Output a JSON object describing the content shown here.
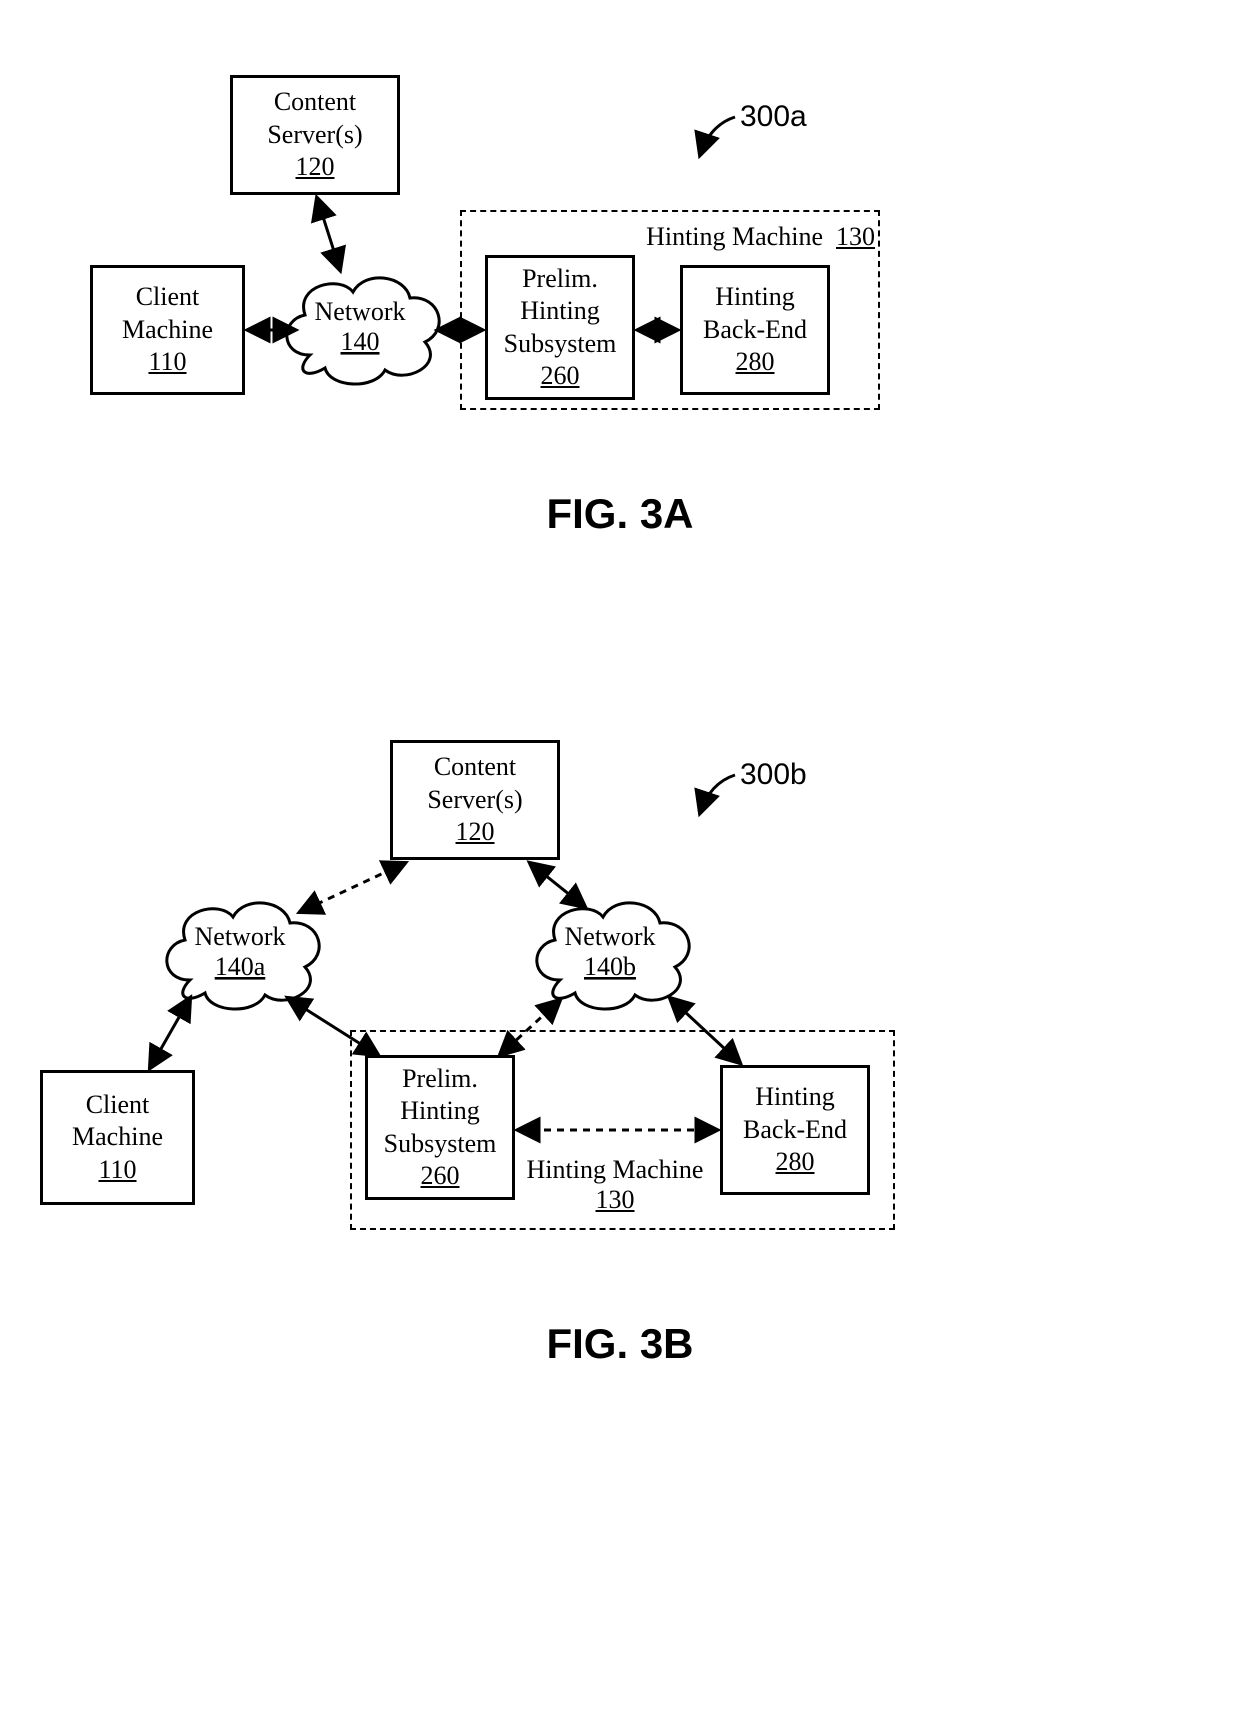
{
  "figA": {
    "ref": "300a",
    "caption": "FIG. 3A",
    "client": {
      "l1": "Client",
      "l2": "Machine",
      "num": "110"
    },
    "content": {
      "l1": "Content",
      "l2": "Server(s)",
      "num": "120"
    },
    "network": {
      "l1": "Network",
      "num": "140"
    },
    "hmGroup": {
      "label": "Hinting Machine",
      "num": "130"
    },
    "prelim": {
      "l1": "Prelim.",
      "l2": "Hinting",
      "l3": "Subsystem",
      "num": "260"
    },
    "backend": {
      "l1": "Hinting",
      "l2": "Back-End",
      "num": "280"
    }
  },
  "figB": {
    "ref": "300b",
    "caption": "FIG. 3B",
    "client": {
      "l1": "Client",
      "l2": "Machine",
      "num": "110"
    },
    "content": {
      "l1": "Content",
      "l2": "Server(s)",
      "num": "120"
    },
    "netA": {
      "l1": "Network",
      "num": "140a"
    },
    "netB": {
      "l1": "Network",
      "num": "140b"
    },
    "hmGroup": {
      "label": "Hinting Machine",
      "num": "130"
    },
    "prelim": {
      "l1": "Prelim.",
      "l2": "Hinting",
      "l3": "Subsystem",
      "num": "260"
    },
    "backend": {
      "l1": "Hinting",
      "l2": "Back-End",
      "num": "280"
    }
  }
}
